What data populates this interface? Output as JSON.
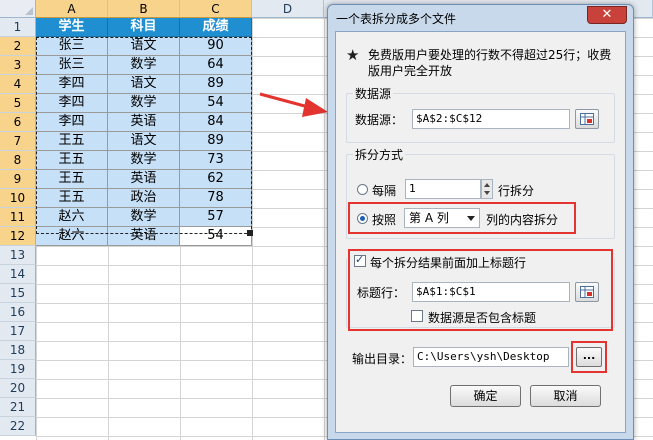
{
  "sheet": {
    "columns": [
      "A",
      "B",
      "C",
      "D"
    ],
    "rows": [
      "1",
      "2",
      "3",
      "4",
      "5",
      "6",
      "7",
      "8",
      "9",
      "10",
      "11",
      "12",
      "13",
      "14",
      "15",
      "16",
      "17",
      "18",
      "19",
      "20",
      "21",
      "22"
    ],
    "headers": [
      "学生",
      "科目",
      "成绩"
    ],
    "data": [
      [
        "张三",
        "语文",
        "90"
      ],
      [
        "张三",
        "数学",
        "64"
      ],
      [
        "李四",
        "语文",
        "89"
      ],
      [
        "李四",
        "数学",
        "54"
      ],
      [
        "李四",
        "英语",
        "84"
      ],
      [
        "王五",
        "语文",
        "89"
      ],
      [
        "王五",
        "数学",
        "73"
      ],
      [
        "王五",
        "英语",
        "62"
      ],
      [
        "王五",
        "政治",
        "78"
      ],
      [
        "赵六",
        "数学",
        "57"
      ],
      [
        "赵六",
        "英语",
        "54"
      ]
    ]
  },
  "dialog": {
    "title": "一个表拆分成多个文件",
    "close_label": "✕",
    "notice": "免费版用户要处理的行数不得超过25行；收费版用户完全开放",
    "source_group": {
      "label": "数据源",
      "field_label": "数据源：",
      "value": "$A$2:$C$12"
    },
    "split_group": {
      "label": "拆分方式",
      "every_label": "每隔",
      "every_value": "1",
      "every_suffix": "行拆分",
      "by_label": "按照",
      "by_value": "第 A 列",
      "by_suffix": "列的内容拆分",
      "selected": "by"
    },
    "header_group": {
      "checkbox_label": "每个拆分结果前面加上标题行",
      "checkbox_checked": true,
      "field_label": "标题行：",
      "value": "$A$1:$C$1",
      "include_label": "数据源是否包含标题",
      "include_checked": false
    },
    "output": {
      "label": "输出目录：",
      "value": "C:\\Users\\ysh\\Desktop",
      "browse_label": "..."
    },
    "ok_label": "确定",
    "cancel_label": "取消"
  },
  "colors": {
    "header_fill": "#1f8fd2",
    "data_fill": "#c6e0f7",
    "highlight": "#e3342f",
    "selected_heading": "#f8d38b"
  }
}
